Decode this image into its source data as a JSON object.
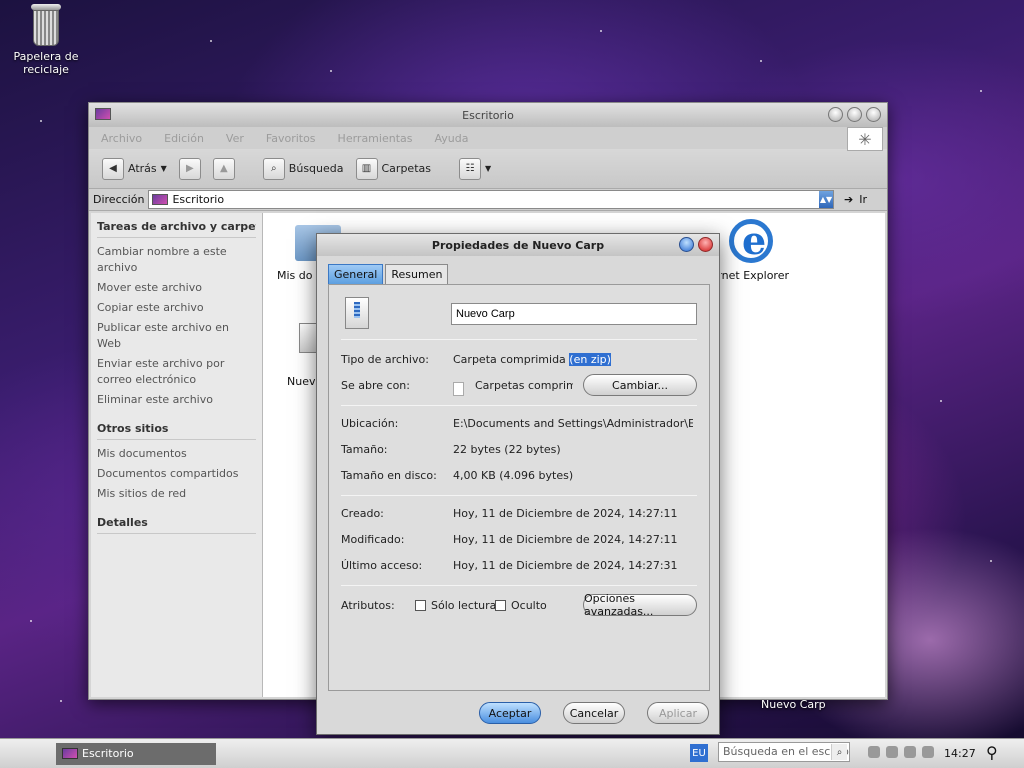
{
  "desktop": {
    "trash_label": "Papelera de reciclaje",
    "bottom_label": "Nuevo Carp"
  },
  "explorer": {
    "title": "Escritorio",
    "menu": [
      "Archivo",
      "Edición",
      "Ver",
      "Favoritos",
      "Herramientas",
      "Ayuda"
    ],
    "toolbar": {
      "back": "Atrás",
      "search": "Búsqueda",
      "folders": "Carpetas"
    },
    "address": {
      "label": "Dirección",
      "value": "Escritorio",
      "go": "Ir"
    },
    "left_pane": {
      "tasks_header": "Tareas de archivo y carpeta",
      "tasks": [
        "Cambiar nombre a este archivo",
        "Mover este archivo",
        "Copiar este archivo",
        "Publicar este archivo en Web",
        "Enviar este archivo por correo electrónico",
        "Eliminar este archivo"
      ],
      "other_header": "Otros sitios",
      "other": [
        "Mis documentos",
        "Documentos compartidos",
        "Mis sitios de red"
      ],
      "details_header": "Detalles"
    },
    "files": {
      "mis_documentos": "Mis documentos",
      "ie": "Internet Explorer",
      "nuevo": "Nuevo Carp"
    }
  },
  "dialog": {
    "title": "Propiedades de Nuevo Carp",
    "tabs": [
      "General",
      "Resumen"
    ],
    "name_value": "Nuevo Carp",
    "type_label": "Tipo de archivo:",
    "type_value": "Carpeta comprimida",
    "type_selected": "(en zip)",
    "opens_label": "Se abre con:",
    "opens_value": "Carpetas comprimidas",
    "change_button": "Cambiar...",
    "location_label": "Ubicación:",
    "location_value": "E:\\Documents and Settings\\Administrador\\Escritorio",
    "size_label": "Tamaño:",
    "size_value": "22 bytes (22 bytes)",
    "disk_label": "Tamaño en disco:",
    "disk_value": "4,00 KB (4.096 bytes)",
    "created_label": "Creado:",
    "created_value": "Hoy, 11 de Diciembre de 2024, 14:27:11",
    "modified_label": "Modificado:",
    "modified_value": "Hoy, 11 de Diciembre de 2024, 14:27:11",
    "accessed_label": "Último acceso:",
    "accessed_value": "Hoy, 11 de Diciembre de 2024, 14:27:31",
    "attributes_label": "Atributos:",
    "readonly_label": "Sólo lectura",
    "hidden_label": "Oculto",
    "advanced_button": "Opciones avanzadas...",
    "ok": "Aceptar",
    "cancel": "Cancelar",
    "apply": "Aplicar"
  },
  "taskbar": {
    "task_label": "Escritorio",
    "lang": "EU",
    "search_placeholder": "Búsqueda en el escritorio",
    "clock": "14:27"
  }
}
